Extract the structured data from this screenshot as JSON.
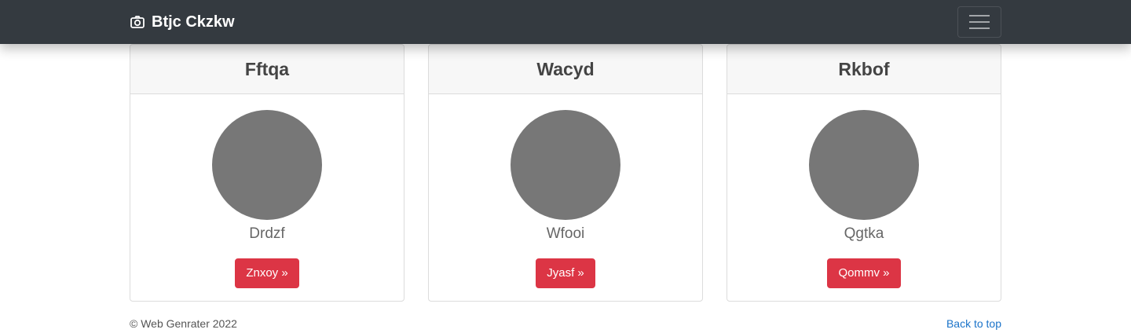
{
  "navbar": {
    "brand": "Btjc Ckzkw",
    "brand_icon": "camera-icon",
    "toggler_icon": "hamburger-menu-icon",
    "background": "#343a40"
  },
  "cards": [
    {
      "title": "Fftqa",
      "name": "Drdzf",
      "button": "Znxoy »"
    },
    {
      "title": "Wacyd",
      "name": "Wfooi",
      "button": "Jyasf »"
    },
    {
      "title": "Rkbof",
      "name": "Qgtka",
      "button": "Qommv »"
    }
  ],
  "footer": {
    "copyright": "© Web Genrater 2022",
    "back_to_top": "Back to top"
  },
  "colors": {
    "accent_button": "#dc3545",
    "avatar": "#777777",
    "link": "#1a73c9"
  }
}
